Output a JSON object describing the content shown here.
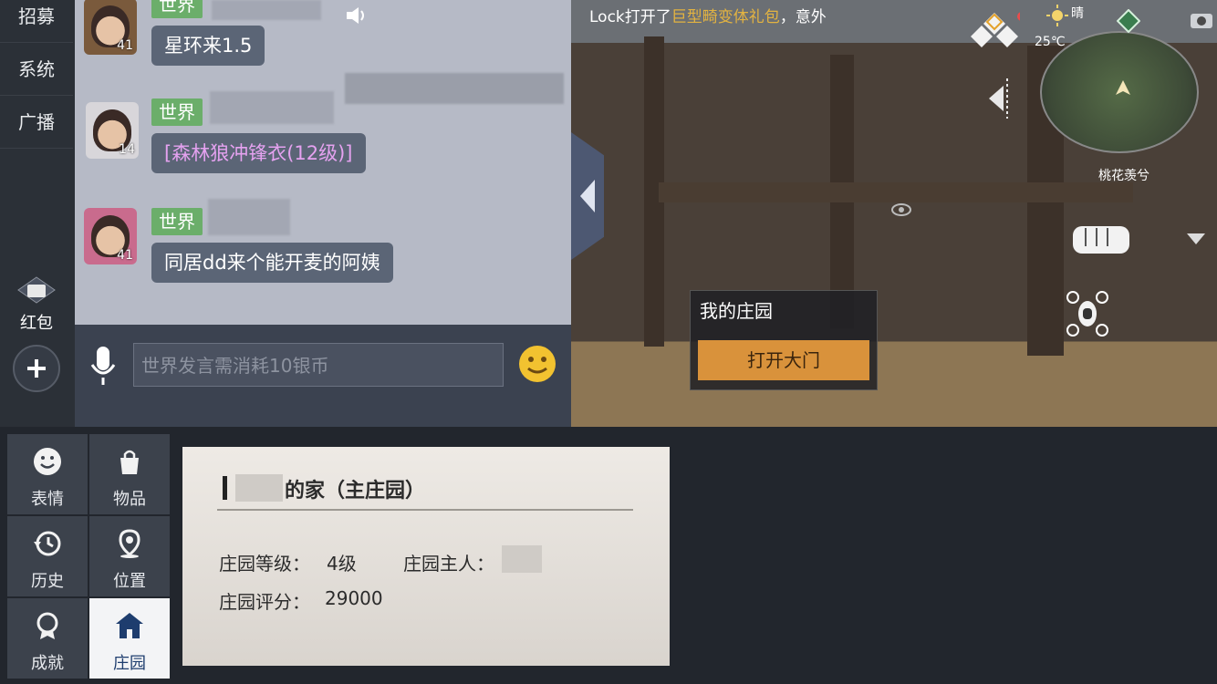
{
  "sidebar": {
    "items": [
      {
        "label": "招募"
      },
      {
        "label": "系统"
      },
      {
        "label": "广播"
      }
    ],
    "red_packet_label": "红包",
    "add_icon": "plus-icon"
  },
  "chat": {
    "messages": [
      {
        "channel": "世界",
        "level": "41",
        "text": "星环来1.5"
      },
      {
        "channel": "世界",
        "level": "14",
        "text": "[森林狼冲锋衣(12级)]"
      },
      {
        "channel": "世界",
        "level": "41",
        "text": "同居dd来个能开麦的阿姨"
      }
    ],
    "input_placeholder": "世界发言需消耗10银币"
  },
  "scene": {
    "notice": {
      "prefix": "Lock打开了",
      "highlight": "巨型畸变体礼包",
      "suffix": "，意外"
    },
    "weather": {
      "condition": "晴",
      "temperature": "25℃"
    },
    "minimap_location": "桃花羡兮",
    "manor_popup": {
      "title": "我的庄园",
      "button": "打开大门"
    }
  },
  "menu": {
    "tiles": [
      {
        "label": "表情",
        "icon": "emoji-icon"
      },
      {
        "label": "物品",
        "icon": "bag-icon"
      },
      {
        "label": "历史",
        "icon": "history-icon"
      },
      {
        "label": "位置",
        "icon": "location-icon"
      },
      {
        "label": "成就",
        "icon": "achievement-icon"
      },
      {
        "label": "庄园",
        "icon": "manor-icon"
      }
    ]
  },
  "manor_card": {
    "title_suffix": "的家（主庄园）",
    "level_label": "庄园等级：",
    "level_value": "4级",
    "owner_label": "庄园主人：",
    "score_label": "庄园评分：",
    "score_value": "29000"
  },
  "colors": {
    "accent_orange": "#d9923b",
    "tag_green": "#6bae6a",
    "highlight_yellow": "#e3b341"
  }
}
